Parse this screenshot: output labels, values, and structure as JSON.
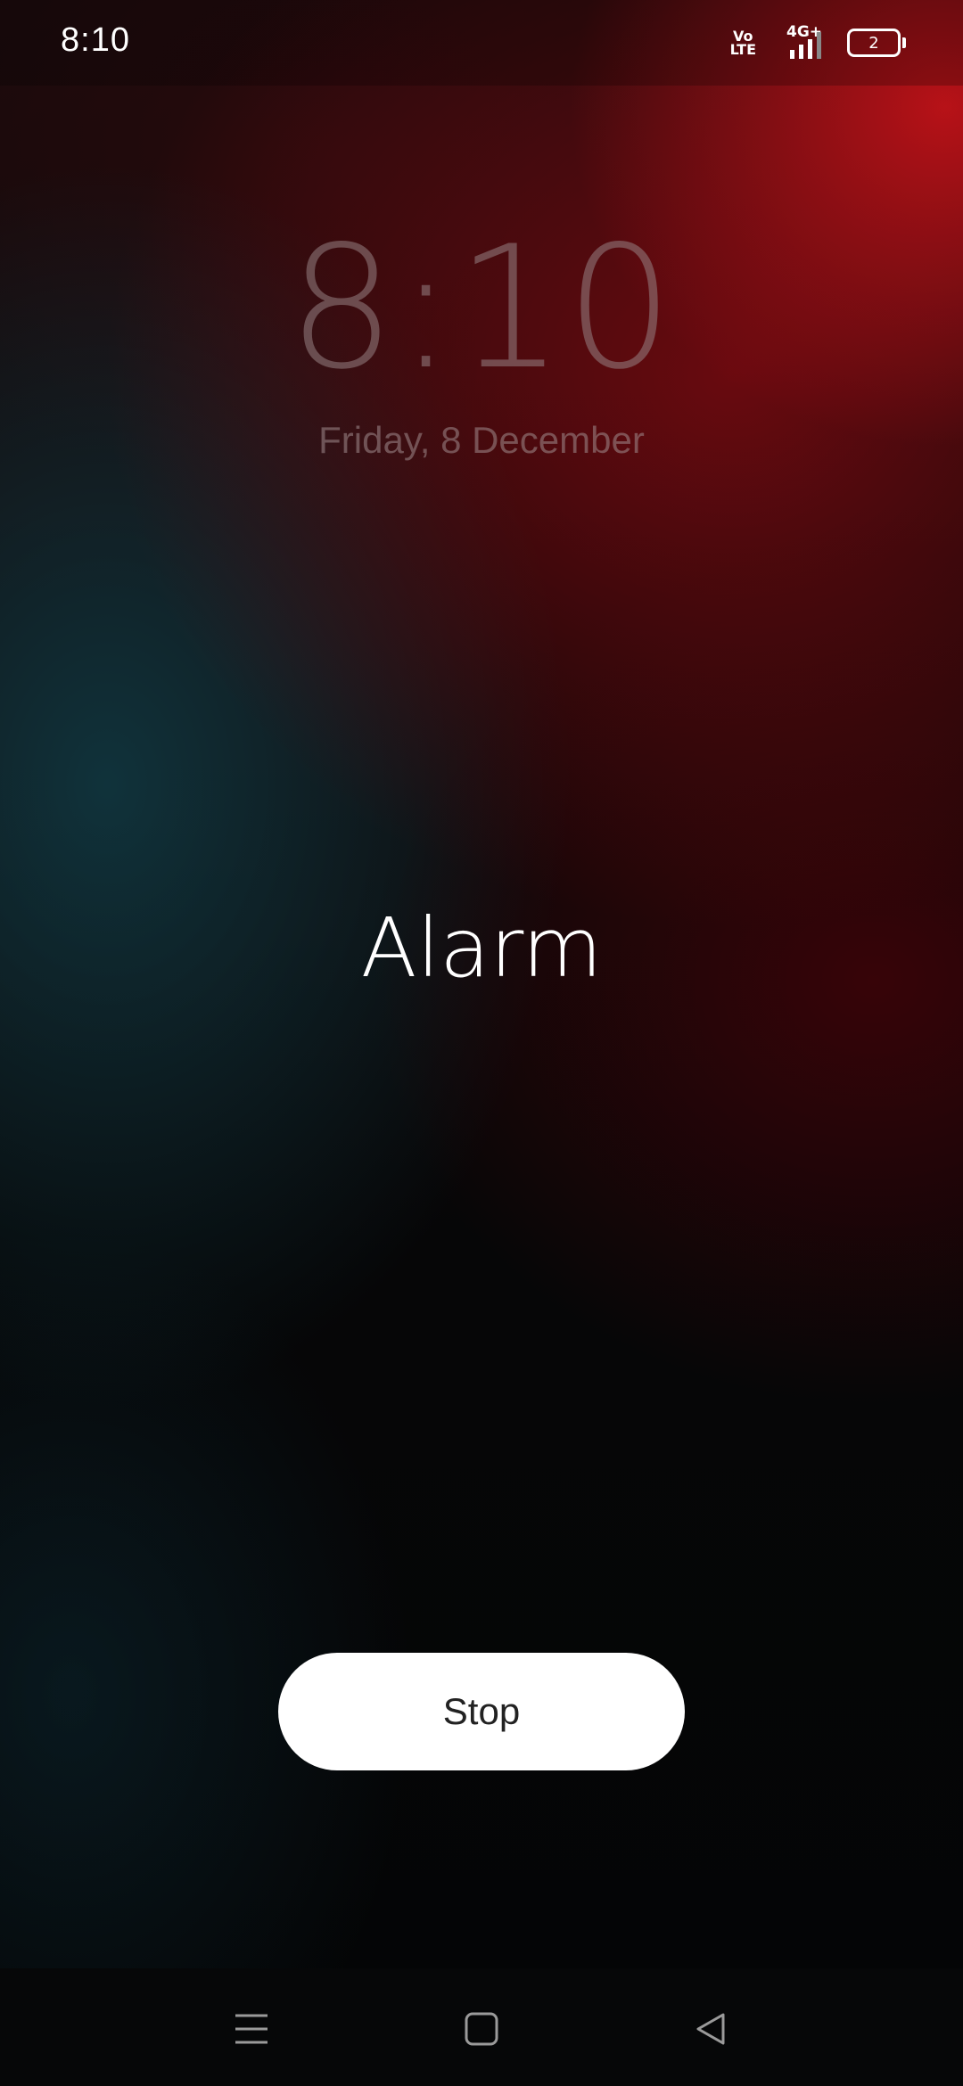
{
  "status_bar": {
    "time": "8:10",
    "volte_top": "Vo",
    "volte_bottom": "LTE",
    "network": "4G+",
    "battery_level": "2",
    "icons": [
      "volte-icon",
      "signal-icon",
      "battery-icon"
    ]
  },
  "lock_screen": {
    "clock": "8:10",
    "date": "Friday, 8 December"
  },
  "alarm": {
    "label": "Alarm",
    "stop_label": "Stop"
  },
  "nav_bar": {
    "icons": [
      "menu-icon",
      "home-icon",
      "back-icon"
    ]
  },
  "colors": {
    "accent_red": "#be1218",
    "teal_glow": "#103a44",
    "button_bg": "#ffffff",
    "button_text": "#222222"
  }
}
